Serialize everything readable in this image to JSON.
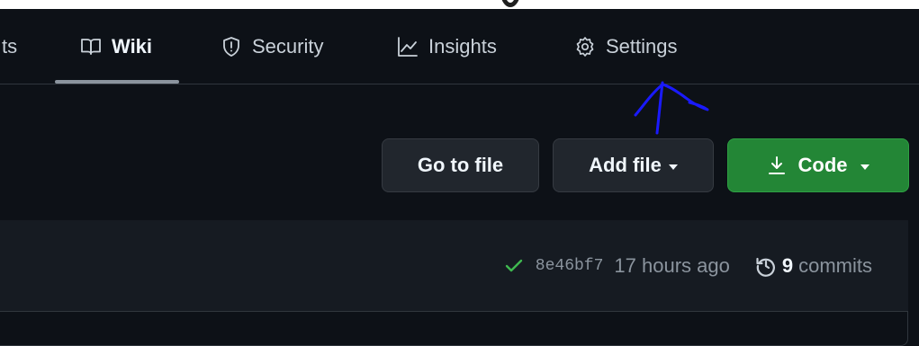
{
  "nav": {
    "tabs": [
      {
        "label": "ts",
        "icon": "none",
        "selected": false
      },
      {
        "label": "Wiki",
        "icon": "book-icon",
        "selected": true
      },
      {
        "label": "Security",
        "icon": "shield-icon",
        "selected": false
      },
      {
        "label": "Insights",
        "icon": "graph-icon",
        "selected": false
      },
      {
        "label": "Settings",
        "icon": "gear-icon",
        "selected": false
      }
    ]
  },
  "toolbar": {
    "goto_label": "Go to file",
    "add_label": "Add file",
    "code_label": "Code"
  },
  "commit": {
    "status_icon": "check-icon",
    "sha": "8e46bf7",
    "time": "17 hours ago",
    "count": "9",
    "count_label": "commits"
  },
  "annotation": {
    "color": "#0000ff",
    "description_icon": "hand-drawn-arrow"
  },
  "colors": {
    "background": "#0d1117",
    "code_button": "#238636",
    "check": "#3fb950",
    "border": "#30363d"
  }
}
